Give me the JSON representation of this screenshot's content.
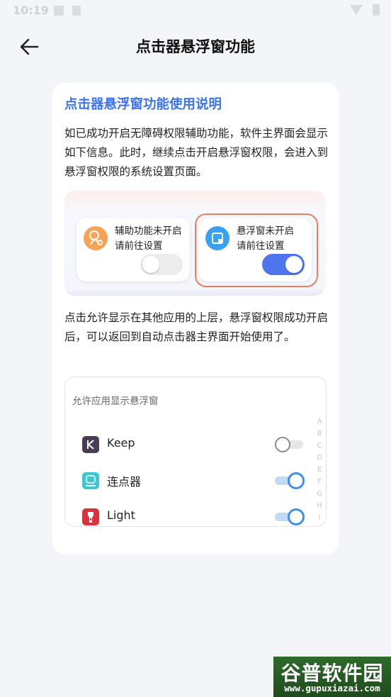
{
  "status_bar": {
    "time": "10:19"
  },
  "header": {
    "title": "点击器悬浮窗功能"
  },
  "card": {
    "title": "点击器悬浮窗功能使用说明",
    "paragraph1": "如已成功开启无障碍权限辅助功能，软件主界面会显示如下信息。此时，继续点击开启悬浮窗权限，会进入到悬浮窗权限的系统设置页面。",
    "illustration": {
      "tile1": {
        "line1": "辅助功能未开启",
        "line2": "请前往设置",
        "switch_on": false
      },
      "tile2": {
        "line1": "悬浮窗未开启",
        "line2": "请前往设置",
        "switch_on": true
      }
    },
    "paragraph2": "点击允许显示在其他应用的上层，悬浮窗权限成功开启后，可以返回到自动点击器主界面开始使用了。",
    "permission_panel": {
      "title": "允许应用显示悬浮窗",
      "apps": [
        {
          "name": "Keep",
          "enabled": false
        },
        {
          "name": "连点器",
          "enabled": true
        },
        {
          "name": "Light",
          "enabled": true
        }
      ],
      "index_letters": [
        "A",
        "B",
        "C",
        "D",
        "E",
        "F",
        "G",
        "H",
        "I"
      ]
    }
  },
  "watermark": {
    "brand": "谷普软件园",
    "url": "www.gupuxiazai.com"
  },
  "colors": {
    "accent": "#3d73f0",
    "highlight": "#ef7d5e",
    "switch_on": "#4f75ee"
  }
}
